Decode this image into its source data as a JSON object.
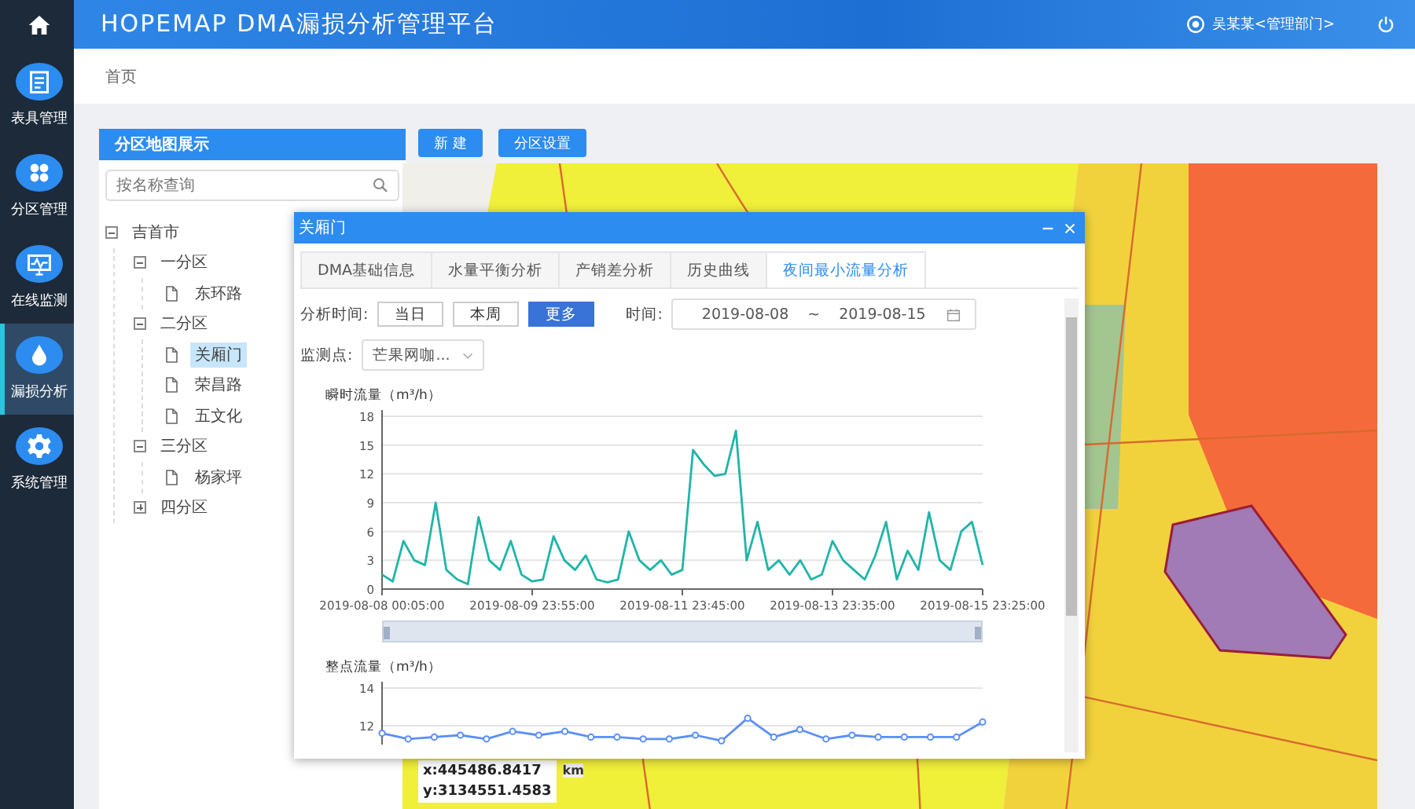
{
  "header": {
    "title": "HOPEMAP DMA漏损分析管理平台",
    "user": "吴某某<管理部门>"
  },
  "sidebar": {
    "items": [
      {
        "kind": "home",
        "selected": false
      },
      {
        "kind": "meter",
        "label": "表具管理",
        "selected": false
      },
      {
        "kind": "zones",
        "label": "分区管理",
        "selected": false
      },
      {
        "kind": "monitor",
        "label": "在线监测",
        "selected": false
      },
      {
        "kind": "leak",
        "label": "漏损分析",
        "selected": true
      },
      {
        "kind": "settings",
        "label": "系统管理",
        "selected": false
      }
    ]
  },
  "breadcrumb": "首页",
  "zone_panel": {
    "title": "分区地图展示",
    "search": {
      "placeholder": "按名称查询"
    },
    "tree": [
      {
        "label": "吉首市",
        "kind": "group",
        "expanded": true,
        "children": [
          {
            "label": "一分区",
            "kind": "group",
            "expanded": true,
            "children": [
              {
                "label": "东环路",
                "kind": "leaf",
                "selected": false
              }
            ]
          },
          {
            "label": "二分区",
            "kind": "group",
            "expanded": true,
            "children": [
              {
                "label": "关厢门",
                "kind": "leaf",
                "selected": true
              },
              {
                "label": "荣昌路",
                "kind": "leaf",
                "selected": false
              },
              {
                "label": "五文化",
                "kind": "leaf",
                "selected": false
              }
            ]
          },
          {
            "label": "三分区",
            "kind": "group",
            "expanded": true,
            "children": [
              {
                "label": "杨家坪",
                "kind": "leaf",
                "selected": false
              }
            ]
          },
          {
            "label": "四分区",
            "kind": "group",
            "expanded": false
          }
        ]
      }
    ]
  },
  "toolbar": {
    "buttons": [
      "新 建",
      "分区设置"
    ]
  },
  "map": {
    "coord_x": "x:445486.8417",
    "coord_y": "y:3134551.4583",
    "scale_unit": "km"
  },
  "dialog": {
    "title": "关厢门",
    "tabs": [
      {
        "label": "DMA基础信息",
        "selected": false
      },
      {
        "label": "水量平衡分析",
        "selected": false
      },
      {
        "label": "产销差分析",
        "selected": false
      },
      {
        "label": "历史曲线",
        "selected": false
      },
      {
        "label": "夜间最小流量分析",
        "selected": true
      }
    ],
    "period_label": "分析时间:",
    "periods": [
      {
        "label": "当日",
        "selected": false
      },
      {
        "label": "本周",
        "selected": false
      },
      {
        "label": "更多",
        "selected": true
      }
    ],
    "time_label": "时间:",
    "date_from": "2019-08-08",
    "date_sep": "~",
    "date_to": "2019-08-15",
    "point_label": "监测点:",
    "point_value": "芒果网咖...",
    "charts": [
      {
        "kind": "chart",
        "chart_data": {
          "type": "line",
          "title": "瞬时流量（m³/h）",
          "ylim": [
            0,
            18
          ],
          "yticks": [
            0,
            3,
            6,
            9,
            12,
            15,
            18
          ],
          "grid": true,
          "categories": [
            "2019-08-08 00:05:00",
            null,
            null,
            null,
            null,
            null,
            null,
            null,
            null,
            null,
            null,
            null,
            null,
            null,
            "2019-08-09 23:55:00",
            null,
            null,
            null,
            null,
            null,
            null,
            null,
            null,
            null,
            null,
            null,
            null,
            null,
            "2019-08-11 23:45:00",
            null,
            null,
            null,
            null,
            null,
            null,
            null,
            null,
            null,
            null,
            null,
            null,
            null,
            "2019-08-13 23:35:00",
            null,
            null,
            null,
            null,
            null,
            null,
            null,
            null,
            null,
            null,
            null,
            null,
            null,
            "2019-08-15 23:25:00"
          ],
          "series": [
            {
              "color": "#1fb5a8",
              "values": [
                1.5,
                0.8,
                5,
                3,
                2.5,
                9,
                2,
                1,
                0.5,
                7.5,
                3,
                2,
                5,
                1.5,
                0.8,
                1,
                5.5,
                3,
                2,
                3.5,
                1,
                0.7,
                1,
                6,
                3,
                2,
                3,
                1.5,
                2,
                14.5,
                13,
                11.8,
                12,
                16.5,
                3,
                7,
                2,
                3,
                1.5,
                3,
                1,
                1.5,
                5,
                3,
                2,
                1,
                3.5,
                7,
                1,
                4,
                2,
                8,
                3,
                2,
                6,
                7,
                2.5
              ]
            }
          ]
        },
        "zoom": {
          "level": 1
        }
      },
      {
        "kind": "chart",
        "chart_data": {
          "type": "line",
          "title": "整点流量（m³/h）",
          "ylim": [
            11,
            14
          ],
          "yticks": [
            12,
            14
          ],
          "grid": true,
          "series": [
            {
              "color": "#5b8ff9",
              "marker": true,
              "values": [
                11.6,
                11.3,
                11.4,
                11.5,
                11.3,
                11.7,
                11.5,
                11.7,
                11.4,
                11.4,
                11.3,
                11.3,
                11.5,
                11.2,
                12.4,
                11.4,
                11.8,
                11.3,
                11.5,
                11.4,
                11.4,
                11.4,
                11.4,
                12.2
              ]
            }
          ]
        }
      }
    ]
  }
}
